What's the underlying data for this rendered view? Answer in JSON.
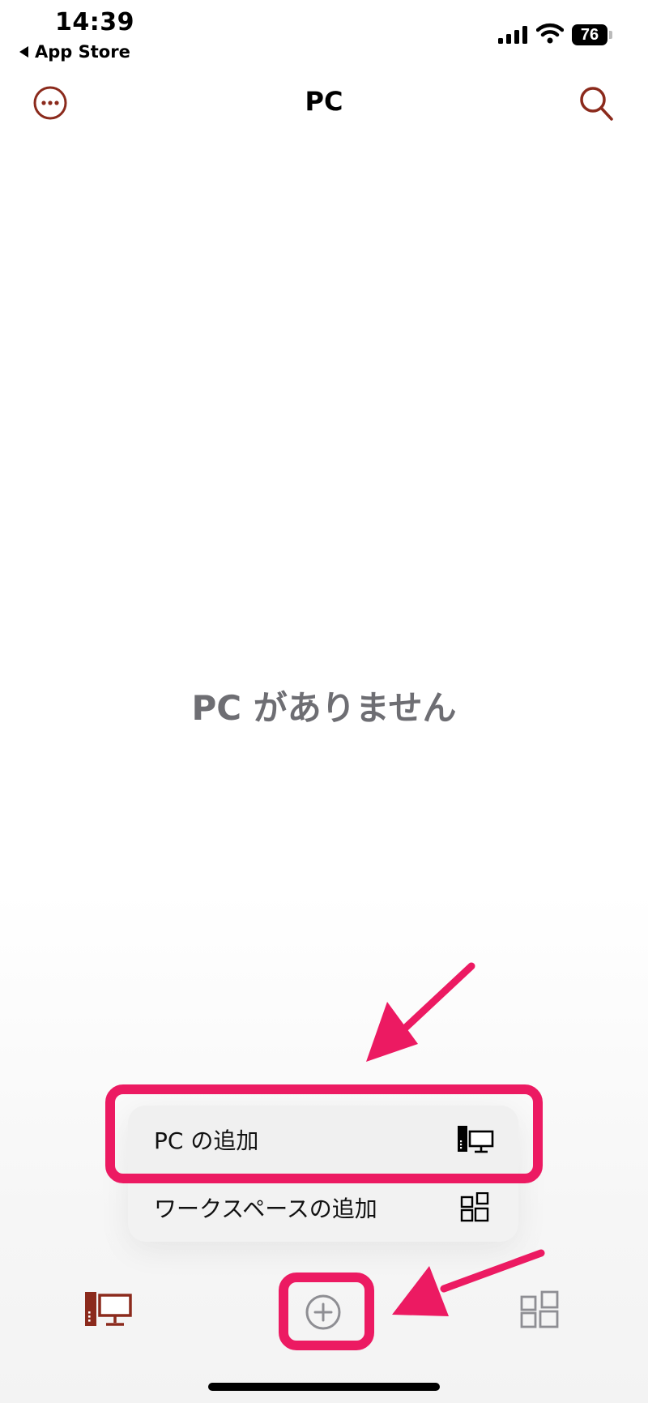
{
  "status_bar": {
    "time": "14:39",
    "back_label": "App Store",
    "battery_level": "76",
    "icons": [
      "cellular-signal-icon",
      "wifi-icon",
      "battery-icon"
    ]
  },
  "nav": {
    "title": "PC",
    "left_icon": "more-ellipsis-circle-icon",
    "right_icon": "search-icon"
  },
  "empty_state": {
    "text": "PC がありません"
  },
  "add_menu": {
    "items": [
      {
        "label": "PC の追加",
        "icon": "pc-desktop-icon"
      },
      {
        "label": "ワークスペースの追加",
        "icon": "workspaces-grid-icon"
      }
    ]
  },
  "tab_bar": {
    "items": [
      {
        "icon": "pcs-tab-icon",
        "selected": true
      },
      {
        "icon": "add-circle-icon",
        "selected": false
      },
      {
        "icon": "workspaces-tab-icon",
        "selected": false
      }
    ]
  },
  "colors": {
    "accent": "#8b2a1c",
    "annotation": "#ec1a62",
    "empty_text": "#6e6e73",
    "inactive_icon": "#8e8e93"
  }
}
